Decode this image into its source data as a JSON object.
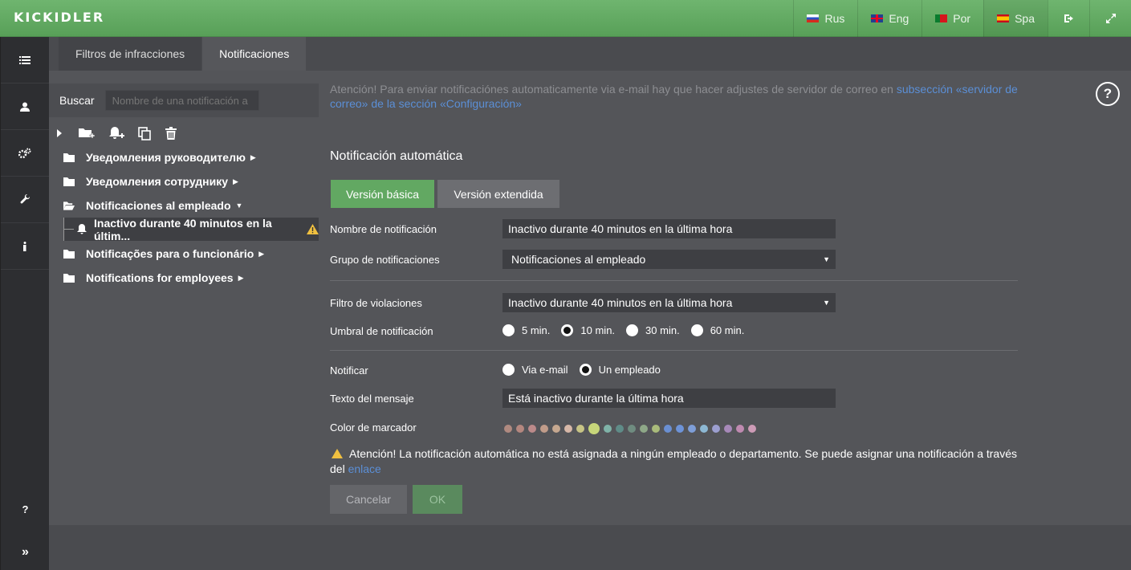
{
  "brand": {
    "logo": "KICKIDLER"
  },
  "languages": [
    {
      "label": "Rus",
      "flag": "ru"
    },
    {
      "label": "Eng",
      "flag": "en"
    },
    {
      "label": "Por",
      "flag": "pt"
    },
    {
      "label": "Spa",
      "flag": "es"
    }
  ],
  "topbar_icons": [
    "logout-icon",
    "fullscreen-icon"
  ],
  "rail": {
    "items": [
      "list-icon",
      "user-icon",
      "settings-icon",
      "wrench-icon",
      "info-icon"
    ],
    "help": "?",
    "expand": "»"
  },
  "tabs": [
    "Filtros de infracciones",
    "Notificaciones"
  ],
  "search": {
    "label": "Buscar",
    "placeholder": "Nombre de una notificación a"
  },
  "tree": {
    "items": [
      "Уведомления руководителю",
      "Уведомления сотруднику",
      "Notificaciones al empleado",
      "Notificações para o funcionário",
      "Notifications for employees"
    ],
    "selected_child": "Inactivo durante 40 minutos en la últim..."
  },
  "notice": {
    "text": "Atención! Para enviar notificaciónes automaticamente via e-mail hay que hacer adjustes de servidor de correo en ",
    "link": "subsección «servidor de correo» de la sección «Configuración»"
  },
  "form": {
    "title": "Notificación automática",
    "version_basic": "Versión básica",
    "version_extended": "Versión extendida",
    "name_label": "Nombre de notificación",
    "name_value": "Inactivo durante 40 minutos en la última hora",
    "group_label": "Grupo de notificaciones",
    "group_value": "Notificaciones al empleado",
    "filter_label": "Filtro de violaciones",
    "filter_value": "Inactivo durante 40 minutos en la última hora",
    "threshold_label": "Umbral de notificación",
    "threshold_options": [
      "5 min.",
      "10 min.",
      "30 min.",
      "60 min."
    ],
    "threshold_selected": "10 min.",
    "notify_label": "Notificar",
    "notify_options": [
      "Via e-mail",
      "Un empleado"
    ],
    "notify_selected": "Un empleado",
    "message_label": "Texto del mensaje",
    "message_value": "Está inactivo durante la última hora",
    "color_label": "Color de marcador",
    "colors": [
      "#b08a80",
      "#b4877f",
      "#bc8a8a",
      "#c19c8a",
      "#c6a890",
      "#d7b8a8",
      "#c7c485",
      "#c7d67a",
      "#7fb3a8",
      "#5f8c88",
      "#6f8c80",
      "#8ea888",
      "#a9bb7b",
      "#6a8fd2",
      "#6d93d8",
      "#7e9ed8",
      "#8db8d4",
      "#9c9fd0",
      "#a789b9",
      "#bf8ab0",
      "#cd9bb6"
    ],
    "color_selected_index": 7,
    "warning_text": "Atención! La notificación automática no está asignada a ningún empleado o departamento. Se puede asignar una notificación a través del ",
    "warning_link": "enlace",
    "cancel": "Cancelar",
    "ok": "OK"
  }
}
